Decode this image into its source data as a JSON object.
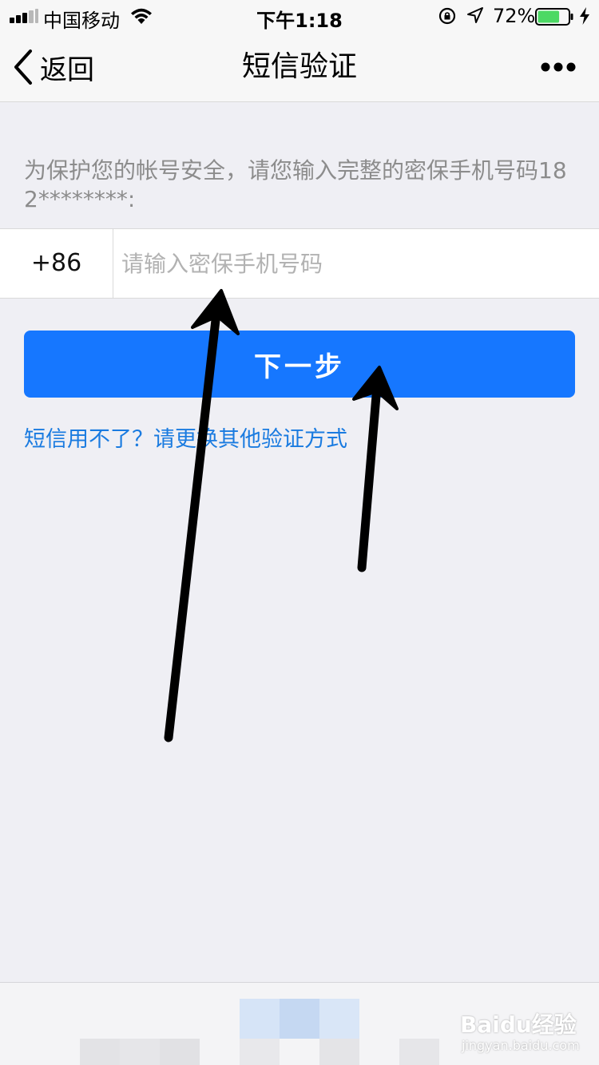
{
  "status_bar": {
    "carrier": "中国移动",
    "time": "下午1:18",
    "battery_percent": "72%",
    "signal_bars_on": 3,
    "signal_bars_total": 5,
    "battery_level": 0.72,
    "battery_color": "#4cd964",
    "icons": [
      "signal-icon",
      "wifi-icon",
      "rotation-lock-icon",
      "location-arrow-icon",
      "battery-icon",
      "charging-bolt-icon"
    ]
  },
  "nav": {
    "back_label": "返回",
    "title": "短信验证",
    "more_icon": "more-dots-icon"
  },
  "hint": "为保护您的帐号安全，请您输入完整的密保手机号码182********:",
  "phone": {
    "country_code": "+86",
    "value": "",
    "placeholder": "请输入密保手机号码"
  },
  "next_button": "下一步",
  "alt_link": "短信用不了？请更换其他验证方式",
  "colors": {
    "accent": "#1677ff",
    "link": "#1a7be0",
    "background": "#efeff4"
  },
  "watermark": {
    "brand": "Baidu经验",
    "url": "jingyan.baidu.com"
  }
}
